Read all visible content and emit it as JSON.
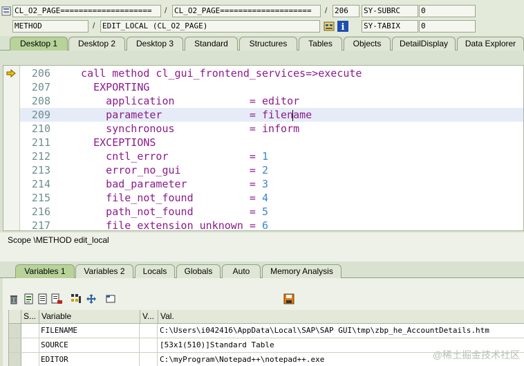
{
  "header": {
    "field1": "CL_O2_PAGE====================",
    "field2": "CL_O2_PAGE====================",
    "line_no": "206",
    "subrc_label": "SY-SUBRC",
    "subrc_value": "0",
    "event_type": "METHOD",
    "event_name": "EDIT_LOCAL (CL_O2_PAGE)",
    "tabix_label": "SY-TABIX",
    "tabix_value": "0",
    "sep": "/"
  },
  "tabs": [
    {
      "label": "Desktop 1",
      "active": true
    },
    {
      "label": "Desktop 2"
    },
    {
      "label": "Desktop 3"
    },
    {
      "label": "Standard"
    },
    {
      "label": "Structures"
    },
    {
      "label": "Tables"
    },
    {
      "label": "Objects"
    },
    {
      "label": "DetailDisplay"
    },
    {
      "label": "Data Explorer"
    }
  ],
  "code": {
    "lines": [
      {
        "num": "206",
        "text": "  call method cl_gui_frontend_services=>execute"
      },
      {
        "num": "207",
        "text": "    EXPORTING"
      },
      {
        "num": "208",
        "p1": "      application",
        "p2": "            = ",
        "p3": "editor"
      },
      {
        "num": "209",
        "p1": "      parameter",
        "p2": "              = ",
        "p3a": "filen",
        "p3b": "ame"
      },
      {
        "num": "210",
        "p1": "      synchronous",
        "p2": "            = ",
        "p3": "inform"
      },
      {
        "num": "211",
        "text": "    EXCEPTIONS"
      },
      {
        "num": "212",
        "p1": "      cntl_error",
        "p2": "             = ",
        "n": "1"
      },
      {
        "num": "213",
        "p1": "      error_no_gui",
        "p2": "           = ",
        "n": "2"
      },
      {
        "num": "214",
        "p1": "      bad_parameter",
        "p2": "          = ",
        "n": "3"
      },
      {
        "num": "215",
        "p1": "      file_not_found",
        "p2": "         = ",
        "n": "4"
      },
      {
        "num": "216",
        "p1": "      path_not_found",
        "p2": "         = ",
        "n": "5"
      },
      {
        "num": "217",
        "p1": "      file_extension_unknown",
        "p2": " = ",
        "n": "6"
      }
    ]
  },
  "scope": "Scope \\METHOD edit_local",
  "lower_tabs": [
    {
      "label": "Variables 1",
      "active": true
    },
    {
      "label": "Variables 2"
    },
    {
      "label": "Locals"
    },
    {
      "label": "Globals"
    },
    {
      "label": "Auto"
    },
    {
      "label": "Memory Analysis"
    }
  ],
  "grid": {
    "headers": {
      "s": "S...",
      "variable": "Variable",
      "v": "V...",
      "val": "Val."
    },
    "rows": [
      {
        "variable": "FILENAME",
        "value": "C:\\Users\\i042416\\AppData\\Local\\SAP\\SAP GUI\\tmp\\zbp_he_AccountDetails.htm"
      },
      {
        "variable": "SOURCE",
        "value": "[53x1(510)]Standard Table"
      },
      {
        "variable": "EDITOR",
        "value": "C:\\myProgram\\Notepad++\\notepad++.exe"
      }
    ]
  },
  "watermark": "@稀土掘金技术社区"
}
